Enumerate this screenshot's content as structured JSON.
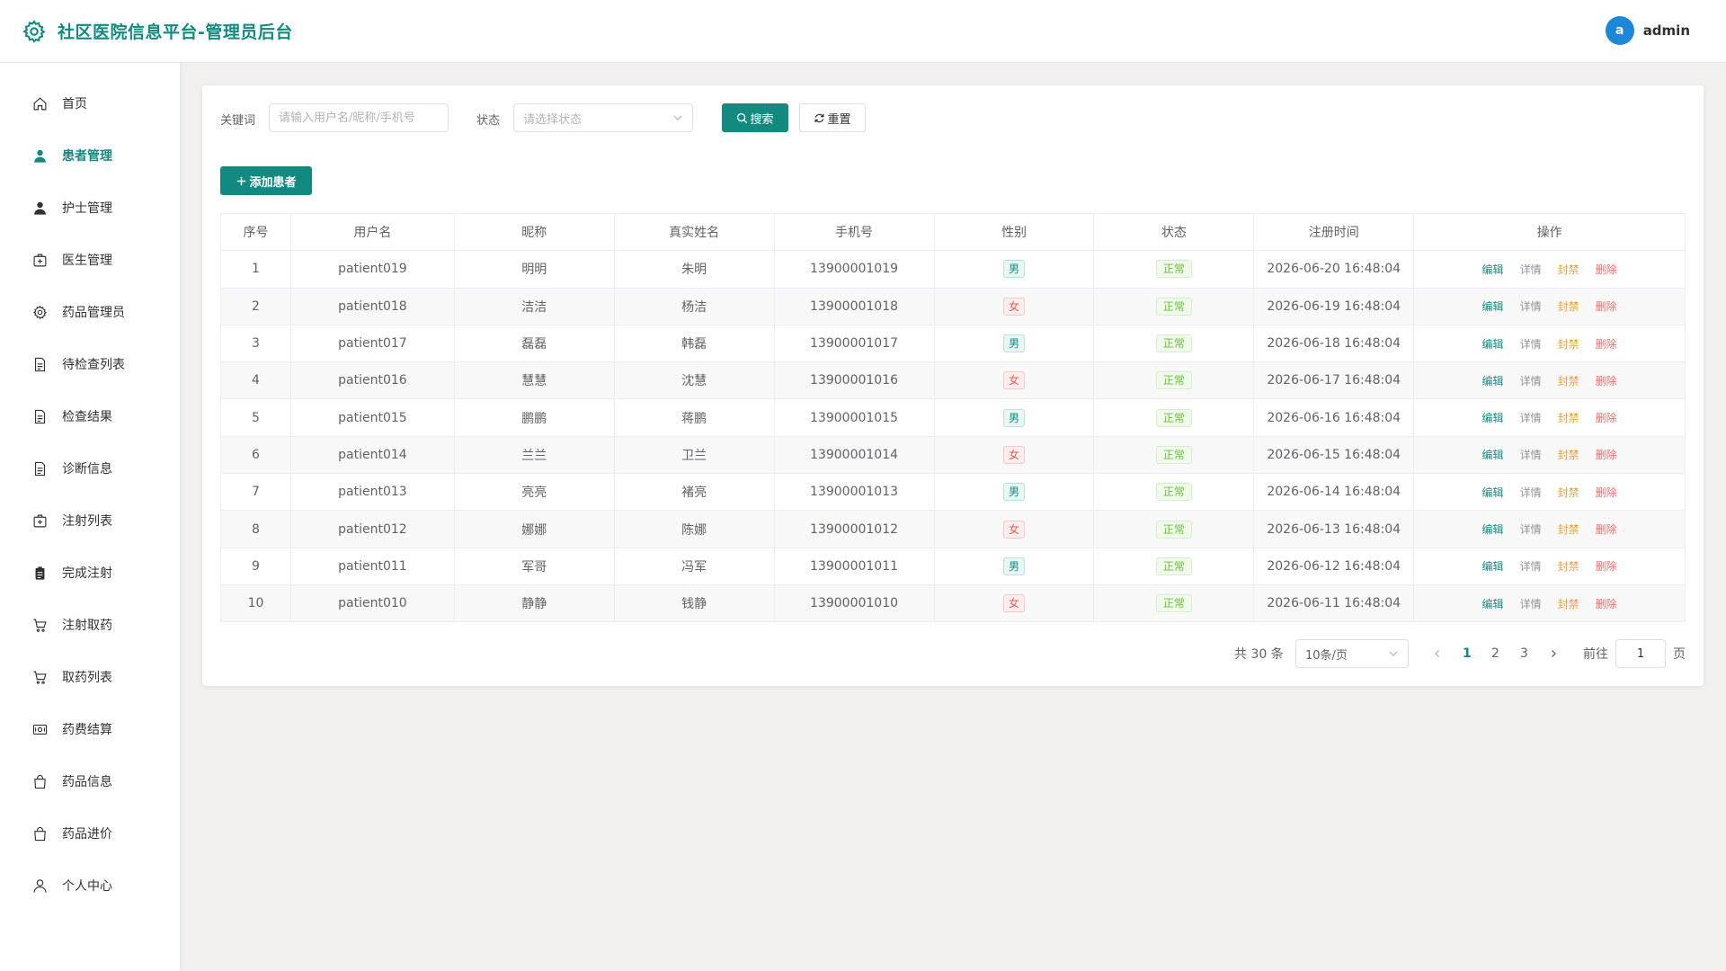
{
  "header": {
    "title": "社区医院信息平台-管理员后台",
    "user": {
      "avatar_letter": "a",
      "name": "admin"
    }
  },
  "sidebar": {
    "items": [
      {
        "label": "首页",
        "icon": "home-icon"
      },
      {
        "label": "患者管理",
        "icon": "user-icon",
        "active": true
      },
      {
        "label": "护士管理",
        "icon": "user-icon"
      },
      {
        "label": "医生管理",
        "icon": "medical-box-icon"
      },
      {
        "label": "药品管理员",
        "icon": "gear-icon"
      },
      {
        "label": "待检查列表",
        "icon": "document-icon"
      },
      {
        "label": "检查结果",
        "icon": "document-icon"
      },
      {
        "label": "诊断信息",
        "icon": "document-icon"
      },
      {
        "label": "注射列表",
        "icon": "medical-box-icon"
      },
      {
        "label": "完成注射",
        "icon": "clipboard-icon"
      },
      {
        "label": "注射取药",
        "icon": "cart-icon"
      },
      {
        "label": "取药列表",
        "icon": "cart-icon"
      },
      {
        "label": "药费结算",
        "icon": "money-icon"
      },
      {
        "label": "药品信息",
        "icon": "bag-icon"
      },
      {
        "label": "药品进价",
        "icon": "bag-icon"
      },
      {
        "label": "个人中心",
        "icon": "person-icon"
      }
    ]
  },
  "filters": {
    "keyword_label": "关键词",
    "keyword_placeholder": "请输入用户名/昵称/手机号",
    "status_label": "状态",
    "status_placeholder": "请选择状态",
    "search_label": "搜索",
    "reset_label": "重置"
  },
  "add_button": {
    "label": "添加患者"
  },
  "table": {
    "columns": [
      "序号",
      "用户名",
      "昵称",
      "真实姓名",
      "手机号",
      "性别",
      "状态",
      "注册时间",
      "操作"
    ],
    "actions": {
      "edit": "编辑",
      "detail": "详情",
      "ban": "封禁",
      "delete": "删除"
    },
    "rows": [
      {
        "index": "1",
        "username": "patient019",
        "nickname": "明明",
        "realname": "朱明",
        "phone": "13900001019",
        "gender": "男",
        "status": "正常",
        "registered": "2026-06-20 16:48:04"
      },
      {
        "index": "2",
        "username": "patient018",
        "nickname": "洁洁",
        "realname": "杨洁",
        "phone": "13900001018",
        "gender": "女",
        "status": "正常",
        "registered": "2026-06-19 16:48:04"
      },
      {
        "index": "3",
        "username": "patient017",
        "nickname": "磊磊",
        "realname": "韩磊",
        "phone": "13900001017",
        "gender": "男",
        "status": "正常",
        "registered": "2026-06-18 16:48:04"
      },
      {
        "index": "4",
        "username": "patient016",
        "nickname": "慧慧",
        "realname": "沈慧",
        "phone": "13900001016",
        "gender": "女",
        "status": "正常",
        "registered": "2026-06-17 16:48:04"
      },
      {
        "index": "5",
        "username": "patient015",
        "nickname": "鹏鹏",
        "realname": "蒋鹏",
        "phone": "13900001015",
        "gender": "男",
        "status": "正常",
        "registered": "2026-06-16 16:48:04"
      },
      {
        "index": "6",
        "username": "patient014",
        "nickname": "兰兰",
        "realname": "卫兰",
        "phone": "13900001014",
        "gender": "女",
        "status": "正常",
        "registered": "2026-06-15 16:48:04"
      },
      {
        "index": "7",
        "username": "patient013",
        "nickname": "亮亮",
        "realname": "褚亮",
        "phone": "13900001013",
        "gender": "男",
        "status": "正常",
        "registered": "2026-06-14 16:48:04"
      },
      {
        "index": "8",
        "username": "patient012",
        "nickname": "娜娜",
        "realname": "陈娜",
        "phone": "13900001012",
        "gender": "女",
        "status": "正常",
        "registered": "2026-06-13 16:48:04"
      },
      {
        "index": "9",
        "username": "patient011",
        "nickname": "军哥",
        "realname": "冯军",
        "phone": "13900001011",
        "gender": "男",
        "status": "正常",
        "registered": "2026-06-12 16:48:04"
      },
      {
        "index": "10",
        "username": "patient010",
        "nickname": "静静",
        "realname": "钱静",
        "phone": "13900001010",
        "gender": "女",
        "status": "正常",
        "registered": "2026-06-11 16:48:04"
      }
    ]
  },
  "pagination": {
    "total_text": "共 30 条",
    "page_size": "10条/页",
    "pages": [
      "1",
      "2",
      "3"
    ],
    "current_page": "1",
    "goto_label": "前往",
    "goto_value": "1",
    "goto_suffix": "页"
  },
  "colors": {
    "accent": "#138a80",
    "male": "#138a80",
    "female": "#e85a5a",
    "status_ok": "#67c23a",
    "ban": "#e6a23c",
    "delete": "#f56c6c"
  }
}
